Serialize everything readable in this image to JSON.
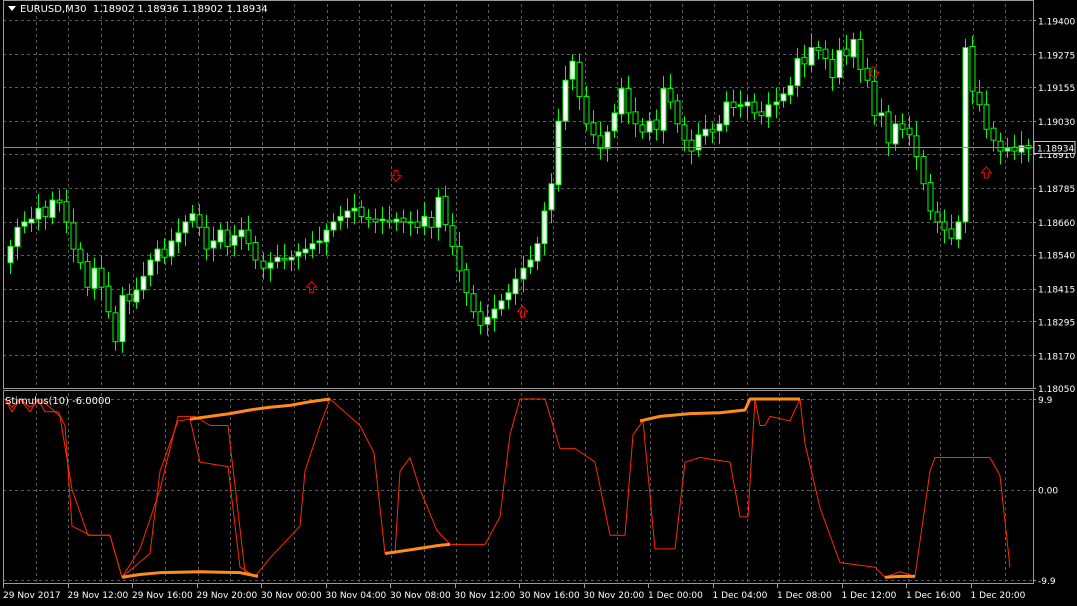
{
  "header": {
    "symbol": "EURUSD,M30",
    "quote": "1.18902 1.18936 1.18902 1.18934"
  },
  "indicator": {
    "title": "Stimulus(10) -6.0000"
  },
  "colors": {
    "background": "#000000",
    "grid": "#5a5a5a",
    "candle": "#00ff00",
    "bull_body": "#ffffff",
    "bear_body": "#000000",
    "arrow": "#ff0000",
    "indicator_thin": "#ff2a00",
    "indicator_thick": "#ff8c1a",
    "current_price_line": "#8c8c8c"
  },
  "chart_data": [
    {
      "type": "candlestick",
      "title": "EURUSD,M30",
      "ylim": [
        1.1805,
        1.1946
      ],
      "price_ticks": [
        "1.19400",
        "1.19275",
        "1.19155",
        "1.19030",
        "1.18910",
        "1.18785",
        "1.18660",
        "1.18540",
        "1.18415",
        "1.18295",
        "1.18170",
        "1.18050"
      ],
      "current_price": "1.18934",
      "time_labels": [
        "29 Nov 2017",
        "29 Nov 12:00",
        "29 Nov 16:00",
        "29 Nov 20:00",
        "30 Nov 00:00",
        "30 Nov 04:00",
        "30 Nov 08:00",
        "30 Nov 12:00",
        "30 Nov 16:00",
        "30 Nov 20:00",
        "1 Dec 00:00",
        "1 Dec 04:00",
        "1 Dec 08:00",
        "1 Dec 12:00",
        "1 Dec 16:00",
        "1 Dec 20:00"
      ],
      "close": [
        1.1857,
        1.1864,
        1.1866,
        1.1867,
        1.1871,
        1.1868,
        1.1874,
        1.1873,
        1.1866,
        1.1856,
        1.1851,
        1.1842,
        1.1849,
        1.1842,
        1.1833,
        1.1822,
        1.1839,
        1.1837,
        1.1841,
        1.1846,
        1.1852,
        1.1856,
        1.1853,
        1.1859,
        1.1862,
        1.1866,
        1.1869,
        1.1864,
        1.1856,
        1.1859,
        1.1863,
        1.1857,
        1.1861,
        1.1863,
        1.1858,
        1.1852,
        1.1849,
        1.1851,
        1.1853,
        1.1852,
        1.1853,
        1.1855,
        1.1856,
        1.1858,
        1.1859,
        1.1863,
        1.1866,
        1.1868,
        1.187,
        1.1871,
        1.1868,
        1.1867,
        1.1866,
        1.1867,
        1.1866,
        1.1867,
        1.1866,
        1.1866,
        1.1864,
        1.1868,
        1.1864,
        1.1875,
        1.1865,
        1.1857,
        1.1848,
        1.184,
        1.1833,
        1.1828,
        1.1831,
        1.1834,
        1.1837,
        1.184,
        1.1845,
        1.1849,
        1.1852,
        1.1858,
        1.187,
        1.188,
        1.1903,
        1.1918,
        1.1925,
        1.1912,
        1.1902,
        1.1898,
        1.1893,
        1.1899,
        1.1906,
        1.1915,
        1.1906,
        1.1902,
        1.1899,
        1.1903,
        1.19,
        1.1915,
        1.191,
        1.1902,
        1.1896,
        1.1892,
        1.1898,
        1.19,
        1.1899,
        1.1902,
        1.191,
        1.1908,
        1.1909,
        1.191,
        1.1906,
        1.1905,
        1.1909,
        1.191,
        1.1913,
        1.1916,
        1.1926,
        1.1924,
        1.193,
        1.1929,
        1.1926,
        1.1919,
        1.1929,
        1.1927,
        1.1933,
        1.1922,
        1.1918,
        1.1905,
        1.1906,
        1.1895,
        1.1902,
        1.19,
        1.1898,
        1.189,
        1.188,
        1.187,
        1.1866,
        1.1863,
        1.186,
        1.1866,
        1.193,
        1.1914,
        1.1909,
        1.19,
        1.1896,
        1.1892,
        1.1893,
        1.1892,
        1.1894,
        1.1893
      ]
    },
    {
      "type": "line",
      "title": "Stimulus(10) -6.0000",
      "ylim": [
        -9.9,
        9.9
      ],
      "tick_labels": [
        "9.9",
        "0.00",
        "-9.9"
      ]
    }
  ]
}
